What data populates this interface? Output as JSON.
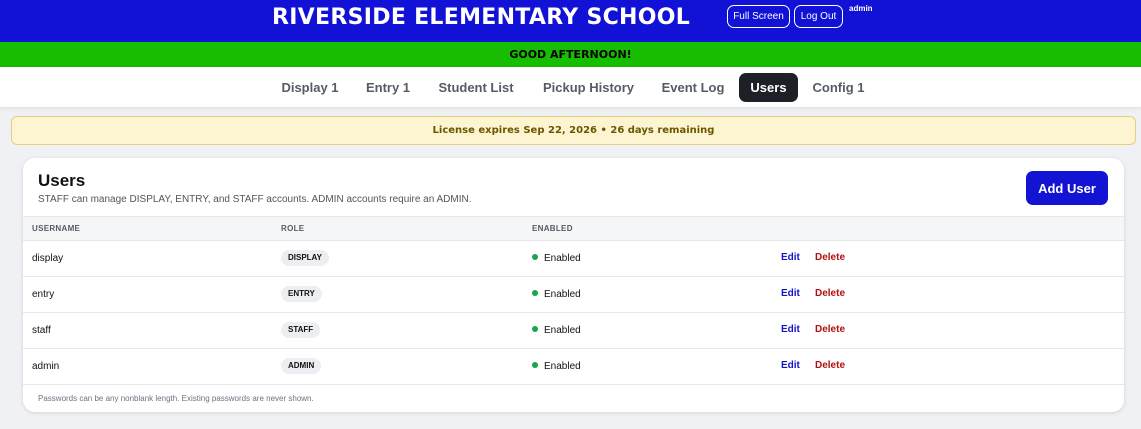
{
  "header": {
    "school_name": "RIVERSIDE ELEMENTARY SCHOOL",
    "full_screen_label": "Full Screen",
    "log_out_label": "Log Out",
    "current_user": "admin",
    "background_color": "#1212d6"
  },
  "greeting": {
    "text": "GOOD AFTERNOON!",
    "background_color": "#17bd00"
  },
  "nav": {
    "tabs": [
      {
        "label": "Display 1",
        "active": false
      },
      {
        "label": "Entry 1",
        "active": false
      },
      {
        "label": "Student List",
        "active": false
      },
      {
        "label": "Pickup History",
        "active": false
      },
      {
        "label": "Event Log",
        "active": false
      },
      {
        "label": "Users",
        "active": true
      },
      {
        "label": "Config 1",
        "active": false
      }
    ]
  },
  "license": {
    "text": "License expires Sep 22, 2026 • 26 days remaining"
  },
  "users_card": {
    "title": "Users",
    "subtitle": "STAFF can manage DISPLAY, ENTRY, and STAFF accounts. ADMIN accounts require an ADMIN.",
    "add_user_label": "Add User",
    "columns": [
      "USERNAME",
      "ROLE",
      "ENABLED"
    ],
    "rows": [
      {
        "username": "display",
        "role": "DISPLAY",
        "status": "Enabled",
        "edit": "Edit",
        "delete": "Delete"
      },
      {
        "username": "entry",
        "role": "ENTRY",
        "status": "Enabled",
        "edit": "Edit",
        "delete": "Delete"
      },
      {
        "username": "staff",
        "role": "STAFF",
        "status": "Enabled",
        "edit": "Edit",
        "delete": "Delete"
      },
      {
        "username": "admin",
        "role": "ADMIN",
        "status": "Enabled",
        "edit": "Edit",
        "delete": "Delete"
      }
    ],
    "footnote": "Passwords can be any nonblank length. Existing passwords are never shown.",
    "status_color": "#1aa34a",
    "accent_color": "#1313d4",
    "delete_color": "#b31010"
  }
}
